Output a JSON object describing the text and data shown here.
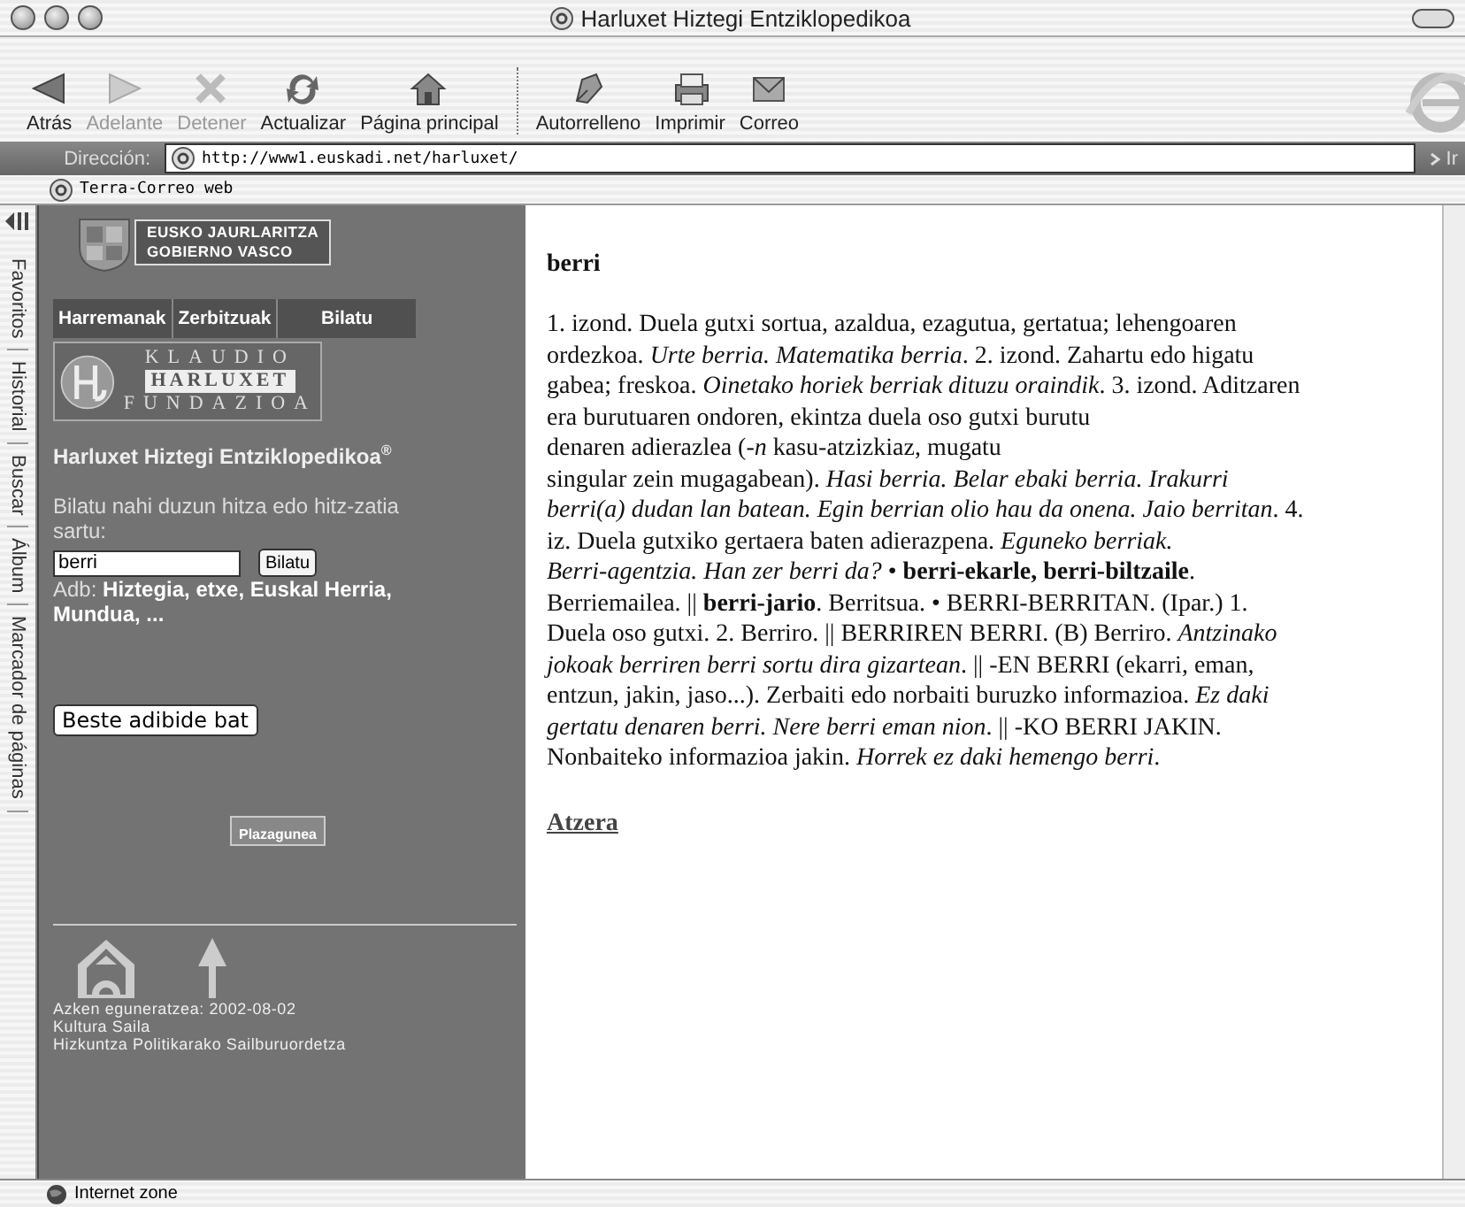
{
  "window": {
    "title": "Harluxet Hiztegi Entziklopedikoa"
  },
  "toolbar": [
    {
      "label": "Atrás",
      "kind": "back",
      "disabled": false
    },
    {
      "label": "Adelante",
      "kind": "forward",
      "disabled": true
    },
    {
      "label": "Detener",
      "kind": "stop",
      "disabled": true
    },
    {
      "label": "Actualizar",
      "kind": "refresh",
      "disabled": false
    },
    {
      "label": "Página principal",
      "kind": "home",
      "disabled": false
    },
    {
      "label": "Autorrelleno",
      "kind": "autofill",
      "disabled": false
    },
    {
      "label": "Imprimir",
      "kind": "print",
      "disabled": false
    },
    {
      "label": "Correo",
      "kind": "mail",
      "disabled": false
    }
  ],
  "address_bar": {
    "label": "Dirección:",
    "value": "http://www1.euskadi.net/harluxet/",
    "go": "Ir"
  },
  "favorites_bar": [
    "Terra-Correo web"
  ],
  "side_tabs": [
    "Favoritos",
    "Historial",
    "Buscar",
    "Álbum",
    "Marcador de páginas"
  ],
  "sidebar": {
    "gov_logo": [
      "EUSKO JAURLARITZA",
      "GOBIERNO VASCO"
    ],
    "nav": [
      "Harremanak",
      "Zerbitzuak",
      "Bilatu"
    ],
    "foundation_logo": [
      "KLAUDIO",
      "HARLUXET",
      "FUNDAZIOA"
    ],
    "title": "Harluxet Hiztegi Entziklopedikoa$^{®}$",
    "prompt": "Bilatu nahi duzun hitza edo hitz-zatia sartu:",
    "search": {
      "value": "berri",
      "button": "Bilatu"
    },
    "examples": "Adb: **Hiztegia, etxe, Euskal Herria, Mundua, ...**",
    "example_button": "Beste adibide bat",
    "banner": "Plazagunea",
    "footer": [
      "Azken eguneratzea: 2002-08-02",
      "Kultura Saila",
      "Hizkuntza Politikarako Sailburuordetza"
    ]
  },
  "entry": {
    "headword": "berri",
    "lines": [
      "1. izond. Duela gutxi sortua, azaldua, ezagutua, gertatua; lehengoaren",
      "ordezkoa. *Urte berria. Matematika berria*. 2. izond. Zahartu edo higatu",
      "gabea; freskoa. *Oinetako horiek berriak dituzu oraindik*. 3. izond. Aditzaren",
      "era burutuaren ondoren, ekintza duela oso gutxi burutu",
      "denaren adierazlea (*-n* kasu-atzizkiaz, mugatu",
      "singular zein mugagabean). *Hasi berria. Belar ebaki berria. Irakurri*",
      "*berri(a) dudan lan batean. Egin berrian olio hau da onena. Jaio berritan*. 4.",
      "iz. Duela gutxiko gertaera baten adierazpena. *Eguneko berriak.*",
      "*Berri-agentzia. Han zer berri da?* • **berri-ekarle, berri-biltzaile**.",
      "Berriemailea. || **berri-jario**. Berritsua. • BERRI-BERRITAN. (Ipar.) 1.",
      "Duela oso gutxi. 2. Berriro. || BERRIREN BERRI. (B) Berriro. *Antzinako*",
      "*jokoak berriren berri sortu dira gizartean*. || -EN BERRI (ekarri, eman,",
      "entzun, jakin, jaso...). Zerbaiti edo norbaiti buruzko informazioa. *Ez daki*",
      "*gertatu denaren berri. Nere berri eman nion*. || -KO BERRI JAKIN.",
      "Nonbaiteko informazioa jakin. *Horrek ez daki hemengo berri*."
    ],
    "back_link": "Atzera"
  },
  "status_bar": {
    "zone": "Internet zone"
  }
}
